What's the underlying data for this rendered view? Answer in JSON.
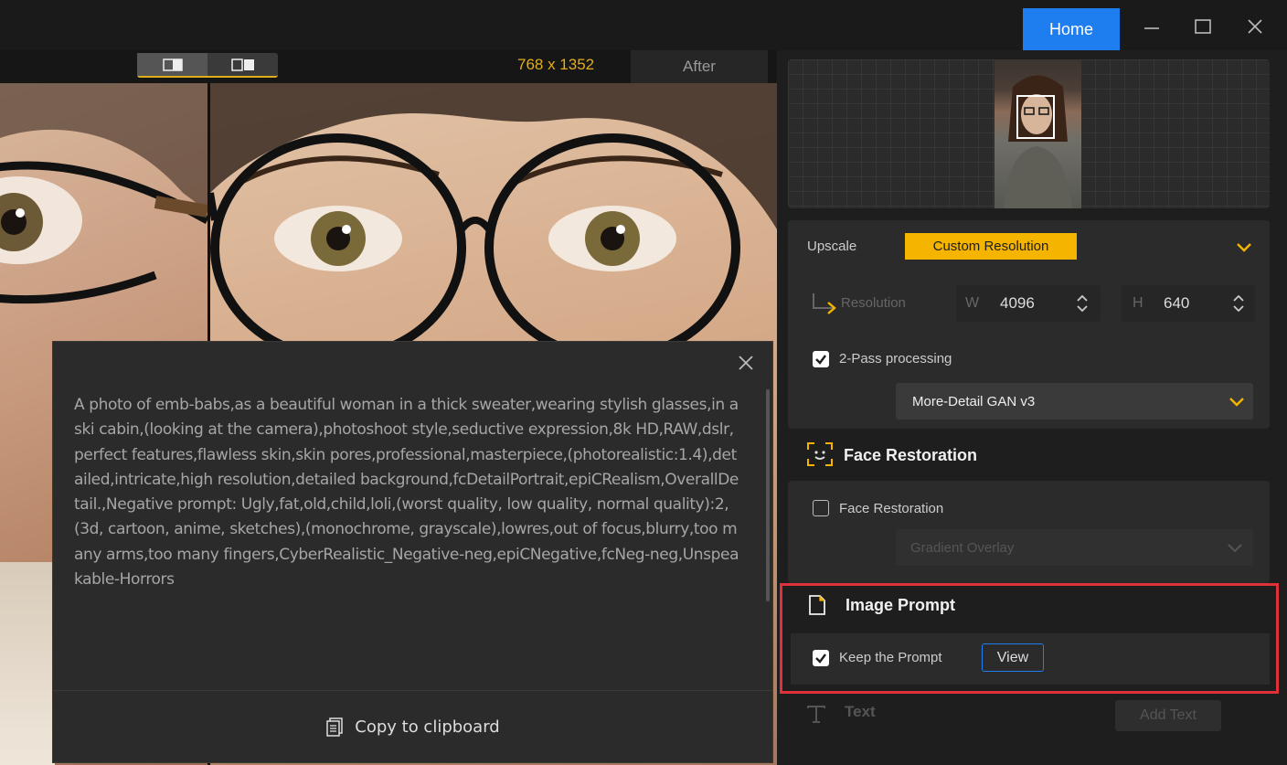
{
  "titlebar": {
    "home_label": "Home"
  },
  "viewer": {
    "resolution": "768 x 1352",
    "after_label": "After"
  },
  "popup": {
    "prompt_text": "A photo of emb-babs,as a beautiful woman in a thick sweater,wearing stylish glasses,in a ski cabin,(looking at the camera),photoshoot style,seductive expression,8k HD,RAW,dslr,perfect features,flawless skin,skin pores,professional,masterpiece,(photorealistic:1.4),detailed,intricate,high resolution,detailed background,fcDetailPortrait,epiCRealism,OverallDetail.,Negative prompt: Ugly,fat,old,child,loli,(worst quality, low quality, normal quality):2,(3d, cartoon, anime, sketches),(monochrome, grayscale),lowres,out of focus,blurry,too many arms,too many fingers,CyberRealistic_Negative-neg,epiCNegative,fcNeg-neg,Unspeakable-Horrors",
    "copy_label": "Copy to clipboard"
  },
  "panel": {
    "upscale_label": "Upscale",
    "upscale_value": "Custom Resolution",
    "resolution_label": "Resolution",
    "width_letter": "W",
    "width_value": "4096",
    "height_letter": "H",
    "height_value": "640",
    "two_pass_label": "2-Pass processing",
    "two_pass_checked": true,
    "model_value": "More-Detail GAN  v3",
    "face_section_title": "Face Restoration",
    "face_checkbox_label": "Face Restoration",
    "face_checked": false,
    "face_model_value": "Gradient Overlay",
    "prompt_section_title": "Image Prompt",
    "keep_prompt_label": "Keep the Prompt",
    "keep_prompt_checked": true,
    "view_label": "View",
    "text_section_title": "Text",
    "add_text_label": "Add Text"
  },
  "colors": {
    "accent_blue": "#1e7ef0",
    "accent_yellow": "#f4b400",
    "highlight_red": "#e0303a"
  }
}
